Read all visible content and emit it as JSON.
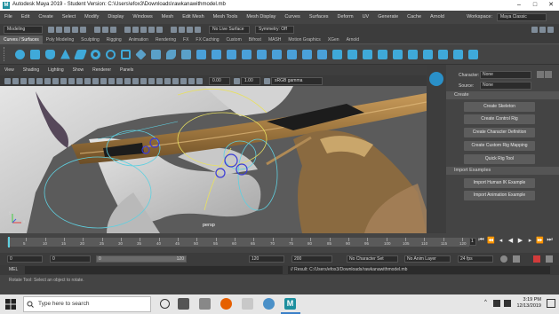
{
  "window": {
    "title": "Autodesk Maya 2019 - Student Version: C:\\Users\\efox3\\Downloads\\rawkanawithmodel.mb",
    "logo": "M",
    "controls": [
      "–",
      "□",
      "✕"
    ]
  },
  "menubar": {
    "items": [
      "File",
      "Edit",
      "Create",
      "Select",
      "Modify",
      "Display",
      "Windows",
      "Mesh",
      "Edit Mesh",
      "Mesh Tools",
      "Mesh Display",
      "Curves",
      "Surfaces",
      "Deform",
      "UV",
      "Generate",
      "Cache",
      "Arnold"
    ],
    "workspace_label": "Workspace:",
    "workspace_value": "Maya Classic"
  },
  "toolbar": {
    "mode": "Modeling",
    "live_surface": "No Live Surface",
    "symmetry": "Symmetry: Off"
  },
  "shelf_tabs": [
    "Curves / Surfaces",
    "Poly Modeling",
    "Sculpting",
    "Rigging",
    "Animation",
    "Rendering",
    "FX",
    "FX Caching",
    "Custom",
    "Bifrost",
    "MASH",
    "Motion Graphics",
    "XGen",
    "Arnold"
  ],
  "viewport": {
    "menu": [
      "View",
      "Shading",
      "Lighting",
      "Show",
      "Renderer",
      "Panels"
    ],
    "field_1": "0.00",
    "field_2": "1.00",
    "colorspace": "sRGB gamma",
    "camera_label": "persp",
    "axis_x": "x",
    "axis_y": "y"
  },
  "right_panel": {
    "character_label": "Character:",
    "character_value": "None",
    "source_label": "Source:",
    "source_value": "None",
    "sections": [
      {
        "title": "Create",
        "buttons": [
          "Create Skeleton",
          "Create Control Rig",
          "Create Character Definition",
          "Create Custom Rig Mapping",
          "Quick Rig Tool"
        ]
      },
      {
        "title": "Import Examples",
        "buttons": [
          "Import Human IK Example",
          "Import Animation Example"
        ]
      }
    ],
    "side_tabs": [
      "Attribute Editor",
      "Modeling Toolkit",
      "Channel Box / Layer Editor",
      "HumanIK"
    ]
  },
  "timeline": {
    "ticks": [
      5,
      10,
      15,
      20,
      25,
      30,
      35,
      40,
      45,
      50,
      55,
      60,
      65,
      70,
      75,
      80,
      85,
      90,
      95,
      100,
      105,
      110,
      115,
      120
    ],
    "current_frame": "1"
  },
  "range": {
    "start": "0",
    "playback_start": "0",
    "range_left": "0",
    "range_right": "120",
    "playback_end": "120",
    "end": "200",
    "character_set": "No Character Set",
    "anim_layer": "No Anim Layer",
    "fps": "24 fps"
  },
  "command_line": {
    "lang": "MEL",
    "result": "// Result: C:/Users/efox3/Downloads/rawkanawithmodel.mb"
  },
  "help_line": "Rotate Tool: Select an object to rotate.",
  "taskbar": {
    "search_placeholder": "Type here to search",
    "time": "3:19 PM",
    "date": "12/13/2019"
  },
  "colors": {
    "accent": "#3fa9d9",
    "maya_teal": "#1d8f9e",
    "viewport_bg": "#5b5b5b",
    "stick": "#a07840"
  }
}
